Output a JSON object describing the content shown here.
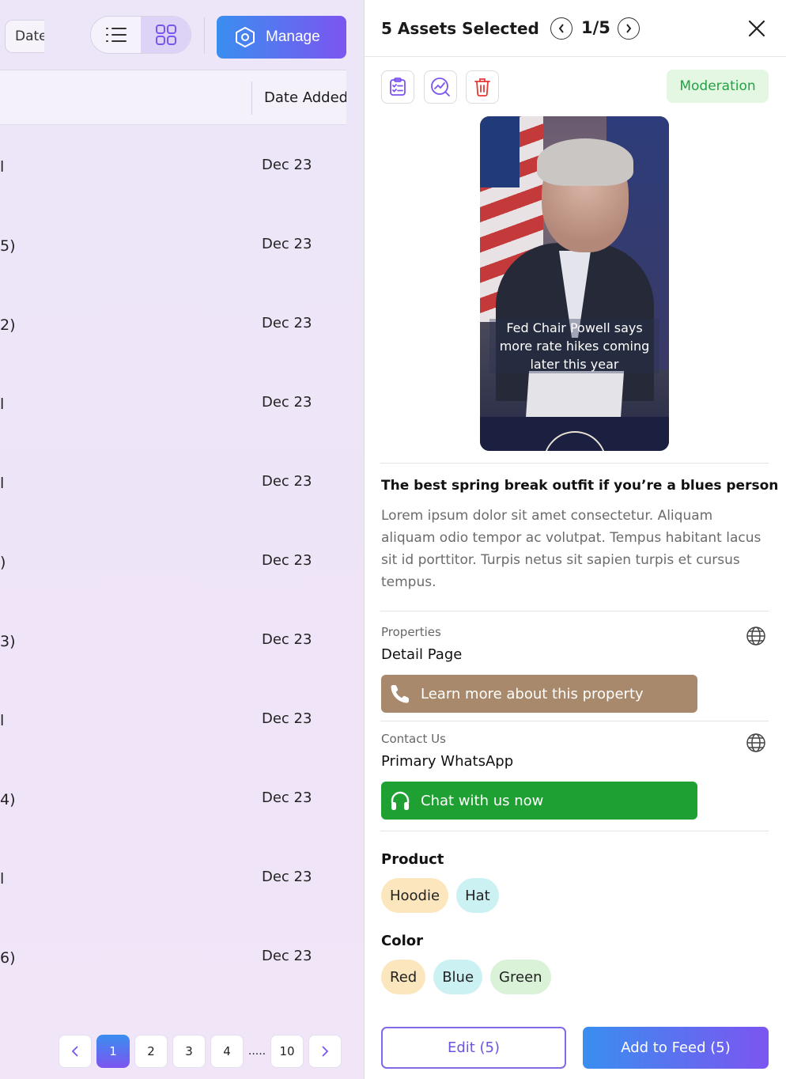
{
  "left": {
    "filter_label": "Date",
    "manage_label": "Manage",
    "column_header_date": "Date Added",
    "rows": [
      {
        "fragment": "l",
        "date": "Dec 23"
      },
      {
        "fragment": "5)",
        "date": "Dec 23"
      },
      {
        "fragment": "2)",
        "date": "Dec 23"
      },
      {
        "fragment": "l",
        "date": "Dec 23"
      },
      {
        "fragment": "l",
        "date": "Dec 23"
      },
      {
        "fragment": ")",
        "date": "Dec 23"
      },
      {
        "fragment": "3)",
        "date": "Dec 23"
      },
      {
        "fragment": "l",
        "date": "Dec 23"
      },
      {
        "fragment": "4)",
        "date": "Dec 23"
      },
      {
        "fragment": "l",
        "date": "Dec 23"
      },
      {
        "fragment": "6)",
        "date": "Dec 23"
      }
    ],
    "pagination": {
      "pages": [
        "1",
        "2",
        "3",
        "4"
      ],
      "ellipsis": ".....",
      "last": "10",
      "current": "1"
    }
  },
  "panel": {
    "title": "5 Assets Selected",
    "position": "1/5",
    "badge": "Moderation",
    "media_caption": "Fed Chair Powell says more rate hikes coming later this year",
    "post_title": "The best spring break outfit if you’re a blues person",
    "post_body": "Lorem ipsum dolor sit amet consectetur. Aliquam aliquam odio tempor ac volutpat. Tempus habitant lacus sit id porttitor. Turpis netus sit sapien turpis et cursus tempus.",
    "properties": {
      "label": "Properties",
      "value": "Detail Page",
      "cta": "Learn more about this property"
    },
    "contact": {
      "label": "Contact Us",
      "value": "Primary WhatsApp",
      "cta": "Chat with us now"
    },
    "product": {
      "title": "Product",
      "chips": [
        "Hoodie",
        "Hat"
      ]
    },
    "color": {
      "title": "Color",
      "chips": [
        "Red",
        "Blue",
        "Green"
      ]
    },
    "edit_label": "Edit (5)",
    "add_label": "Add to Feed (5)"
  },
  "colors": {
    "accent_start": "#3a8ef0",
    "accent_end": "#7c55f0",
    "brown_cta": "#a8896b",
    "green_cta": "#1fa032",
    "moderation_text": "#25a244"
  }
}
